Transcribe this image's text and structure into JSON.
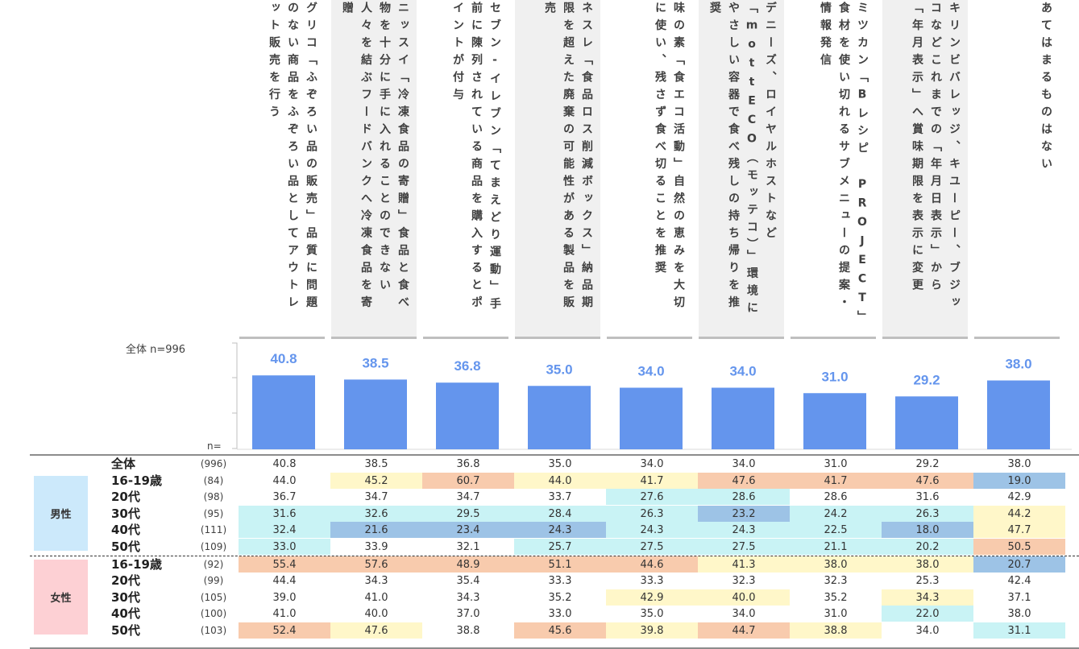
{
  "colors": {
    "bar": "#6495ed",
    "bar_label": "#6495ed",
    "orange": "#f8cbad",
    "yellow": "#fff7c9",
    "cyan": "#c9f3f5",
    "blue": "#9dc3e6",
    "male_group": "#cce9fb",
    "female_group": "#fdd0d4",
    "header_shade": "#f0f0f0"
  },
  "chart_data": {
    "type": "bar",
    "categories": [
      "グリコ「ふぞろい品の販売」品質に問題のない商品をふぞろい品としてアウトレット販売を行う",
      "ニッスイ「冷凍食品の寄贈」食品と食べ物を十分に手に入れることのできない人々を結ぶフードバンクへ冷凍食品を寄贈",
      "セブン-イレブン「てまえどり運動」手前に陳列されている商品を購入するとポイントが付与",
      "ネスレ「食品ロス削減ボックス」納品期限を超えた廃棄の可能性がある製品を販売",
      "味の素「食エコ活動」自然の恵みを大切に使い、残さず食べ切ることを推奨",
      "デニーズ、ロイヤルホストなど「mottECO（モッテコ）」環境にやさしい容器で食べ残しの持ち帰りを推奨",
      "ミツカン「Bレシピ PROJECT」食材を使い切れるサブメニューの提案・情報発信",
      "キリンビバレッジ、キユーピー、ブジッコなどこれまでの「年月日表示」から「年月表示」へ賞味期限を表示に変更",
      "あてはまるものはない"
    ],
    "values": [
      40.8,
      38.5,
      36.8,
      35.0,
      34.0,
      34.0,
      31.0,
      29.2,
      38.0
    ],
    "value_labels": [
      "40.8",
      "38.5",
      "36.8",
      "35.0",
      "34.0",
      "34.0",
      "31.0",
      "29.2",
      "38.0"
    ],
    "total_label": "全体 n=996",
    "n_label": "n=",
    "ylim": [
      0,
      60
    ]
  },
  "table": {
    "groups": [
      {
        "label": "男性"
      },
      {
        "label": "女性"
      }
    ],
    "rows": [
      {
        "label": "全体",
        "n": "(996)",
        "values": [
          "40.8",
          "38.5",
          "36.8",
          "35.0",
          "34.0",
          "34.0",
          "31.0",
          "29.2",
          "38.0"
        ],
        "colors": [
          "",
          "",
          "",
          "",
          "",
          "",
          "",
          "",
          ""
        ]
      },
      {
        "label": "16-19歳",
        "n": "(84)",
        "values": [
          "44.0",
          "45.2",
          "60.7",
          "44.0",
          "41.7",
          "47.6",
          "41.7",
          "47.6",
          "19.0"
        ],
        "colors": [
          "",
          "yellow",
          "orange",
          "yellow",
          "yellow",
          "orange",
          "orange",
          "orange",
          "blue"
        ]
      },
      {
        "label": "20代",
        "n": "(98)",
        "values": [
          "36.7",
          "34.7",
          "34.7",
          "33.7",
          "27.6",
          "28.6",
          "28.6",
          "31.6",
          "42.9"
        ],
        "colors": [
          "",
          "",
          "",
          "",
          "cyan",
          "cyan",
          "",
          "",
          ""
        ]
      },
      {
        "label": "30代",
        "n": "(95)",
        "values": [
          "31.6",
          "32.6",
          "29.5",
          "28.4",
          "26.3",
          "23.2",
          "24.2",
          "26.3",
          "44.2"
        ],
        "colors": [
          "cyan",
          "cyan",
          "cyan",
          "cyan",
          "cyan",
          "blue",
          "cyan",
          "cyan",
          "yellow"
        ]
      },
      {
        "label": "40代",
        "n": "(111)",
        "values": [
          "32.4",
          "21.6",
          "23.4",
          "24.3",
          "24.3",
          "24.3",
          "22.5",
          "18.0",
          "47.7"
        ],
        "colors": [
          "cyan",
          "blue",
          "blue",
          "blue",
          "cyan",
          "cyan",
          "cyan",
          "blue",
          "yellow"
        ]
      },
      {
        "label": "50代",
        "n": "(109)",
        "values": [
          "33.0",
          "33.9",
          "32.1",
          "25.7",
          "27.5",
          "27.5",
          "21.1",
          "20.2",
          "50.5"
        ],
        "colors": [
          "cyan",
          "",
          "",
          "cyan",
          "cyan",
          "cyan",
          "cyan",
          "cyan",
          "orange"
        ]
      },
      {
        "label": "16-19歳",
        "n": "(92)",
        "values": [
          "55.4",
          "57.6",
          "48.9",
          "51.1",
          "44.6",
          "41.3",
          "38.0",
          "38.0",
          "20.7"
        ],
        "colors": [
          "orange",
          "orange",
          "orange",
          "orange",
          "orange",
          "yellow",
          "yellow",
          "yellow",
          "blue"
        ]
      },
      {
        "label": "20代",
        "n": "(99)",
        "values": [
          "44.4",
          "34.3",
          "35.4",
          "33.3",
          "33.3",
          "32.3",
          "32.3",
          "25.3",
          "42.4"
        ],
        "colors": [
          "",
          "",
          "",
          "",
          "",
          "",
          "",
          "",
          ""
        ]
      },
      {
        "label": "30代",
        "n": "(105)",
        "values": [
          "39.0",
          "41.0",
          "34.3",
          "35.2",
          "42.9",
          "40.0",
          "35.2",
          "34.3",
          "37.1"
        ],
        "colors": [
          "",
          "",
          "",
          "",
          "yellow",
          "yellow",
          "",
          "yellow",
          ""
        ]
      },
      {
        "label": "40代",
        "n": "(100)",
        "values": [
          "41.0",
          "40.0",
          "37.0",
          "33.0",
          "35.0",
          "34.0",
          "31.0",
          "22.0",
          "38.0"
        ],
        "colors": [
          "",
          "",
          "",
          "",
          "",
          "",
          "",
          "cyan",
          ""
        ]
      },
      {
        "label": "50代",
        "n": "(103)",
        "values": [
          "52.4",
          "47.6",
          "38.8",
          "45.6",
          "39.8",
          "44.7",
          "38.8",
          "34.0",
          "31.1"
        ],
        "colors": [
          "orange",
          "yellow",
          "",
          "orange",
          "yellow",
          "orange",
          "yellow",
          "",
          "cyan"
        ]
      }
    ]
  }
}
